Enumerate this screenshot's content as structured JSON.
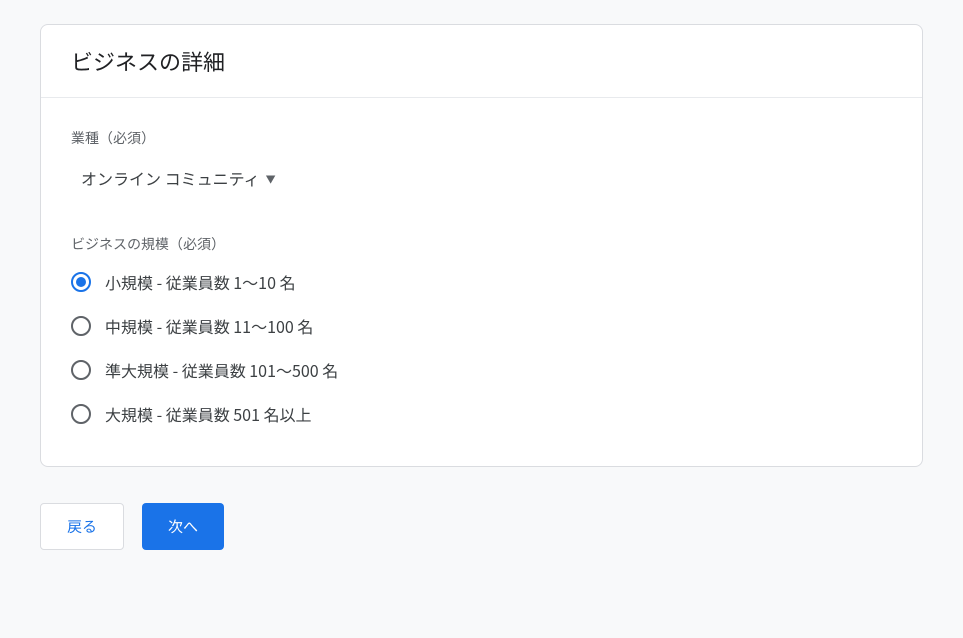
{
  "card": {
    "title": "ビジネスの詳細"
  },
  "industry": {
    "label": "業種（必須）",
    "selected": "オンライン コミュニティ"
  },
  "business_size": {
    "label": "ビジネスの規模（必須）",
    "options": [
      {
        "label": "小規模 - 従業員数 1～10 名",
        "selected": true
      },
      {
        "label": "中規模 - 従業員数 11～100 名",
        "selected": false
      },
      {
        "label": "準大規模 - 従業員数 101～500 名",
        "selected": false
      },
      {
        "label": "大規模 - 従業員数 501 名以上",
        "selected": false
      }
    ]
  },
  "footer": {
    "back": "戻る",
    "next": "次へ"
  }
}
